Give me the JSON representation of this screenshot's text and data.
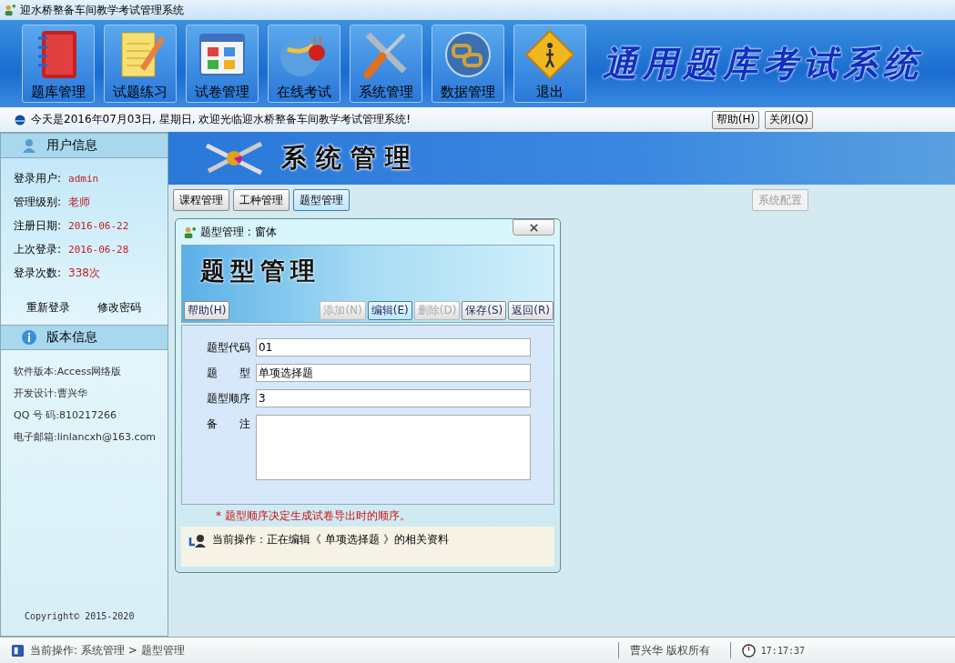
{
  "window": {
    "title": "迎水桥整备车间教学考试管理系统"
  },
  "toolbar": {
    "buttons": [
      {
        "label": "题库管理"
      },
      {
        "label": "试题练习"
      },
      {
        "label": "试卷管理"
      },
      {
        "label": "在线考试"
      },
      {
        "label": "系统管理"
      },
      {
        "label": "数据管理"
      },
      {
        "label": "退出"
      }
    ],
    "app_title": "通用题库考试系统"
  },
  "info_bar": {
    "message": "今天是2016年07月03日, 星期日, 欢迎光临迎水桥整备车间教学考试管理系统!",
    "buttons": [
      "帮助(H)",
      "关闭(Q)"
    ]
  },
  "sidebar": {
    "user_info": {
      "title": "用户信息",
      "fields": [
        {
          "label": "登录用户:",
          "value": "admin"
        },
        {
          "label": "管理级别:",
          "value": "老师"
        },
        {
          "label": "注册日期:",
          "value": "2016-06-22"
        },
        {
          "label": "上次登录:",
          "value": "2016-06-28"
        },
        {
          "label": "登录次数:",
          "value": "338次"
        }
      ],
      "links": [
        "重新登录",
        "修改密码"
      ]
    },
    "version_info": {
      "title": "版本信息",
      "lines": [
        "软件版本:Access网络版",
        "开发设计:曹兴华",
        "QQ 号 码:810217266",
        "电子邮箱:linlancxh@163.com"
      ]
    },
    "copyright": "Copyright© 2015-2020"
  },
  "main": {
    "banner_title": "系统管理",
    "tabs": [
      {
        "label": "课程管理",
        "selected": false
      },
      {
        "label": "工种管理",
        "selected": false
      },
      {
        "label": "题型管理",
        "selected": true
      }
    ],
    "config_button": {
      "label": "系统配置",
      "disabled": true
    }
  },
  "dialog": {
    "title": "题型管理 : 窗体",
    "header_title": "题型管理",
    "help_button": "帮助(H)",
    "buttons": [
      {
        "label": "添加(N)",
        "disabled": true,
        "selected": false
      },
      {
        "label": "编辑(E)",
        "disabled": false,
        "selected": true
      },
      {
        "label": "删除(D)",
        "disabled": true,
        "selected": false
      },
      {
        "label": "保存(S)",
        "disabled": false,
        "selected": false
      },
      {
        "label": "返回(R)",
        "disabled": false,
        "selected": false
      }
    ],
    "fields": [
      {
        "label": "题型代码",
        "value": "01",
        "kind": "text"
      },
      {
        "label": "题　　型",
        "value": "单项选择题",
        "kind": "text"
      },
      {
        "label": "题型顺序",
        "value": "3",
        "kind": "text"
      },
      {
        "label": "备　　注",
        "kind": "textarea"
      }
    ],
    "note": "* 题型顺序决定生成试卷导出时的顺序。",
    "status": "当前操作：正在编辑《 单项选择题 》的相关资料"
  },
  "status_bar": {
    "operation": "当前操作: 系统管理 > 题型管理",
    "copyright": "曹兴华  版权所有",
    "time": "17:17:37"
  }
}
